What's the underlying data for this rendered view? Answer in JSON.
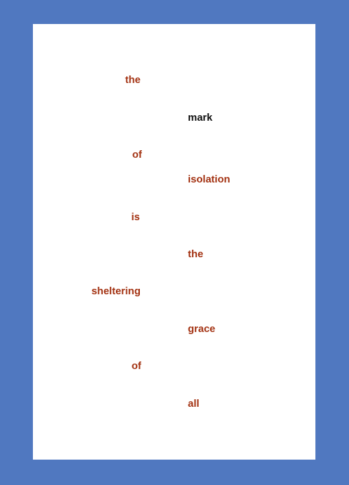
{
  "colors": {
    "frame": "#5078c0",
    "page": "#ffffff",
    "accent_word": "#a33212",
    "highlight_word": "#111111"
  },
  "poem": {
    "words": [
      "the",
      "mark",
      "of",
      "isolation",
      "is",
      "the",
      "sheltering",
      "grace",
      "of",
      "all"
    ]
  }
}
